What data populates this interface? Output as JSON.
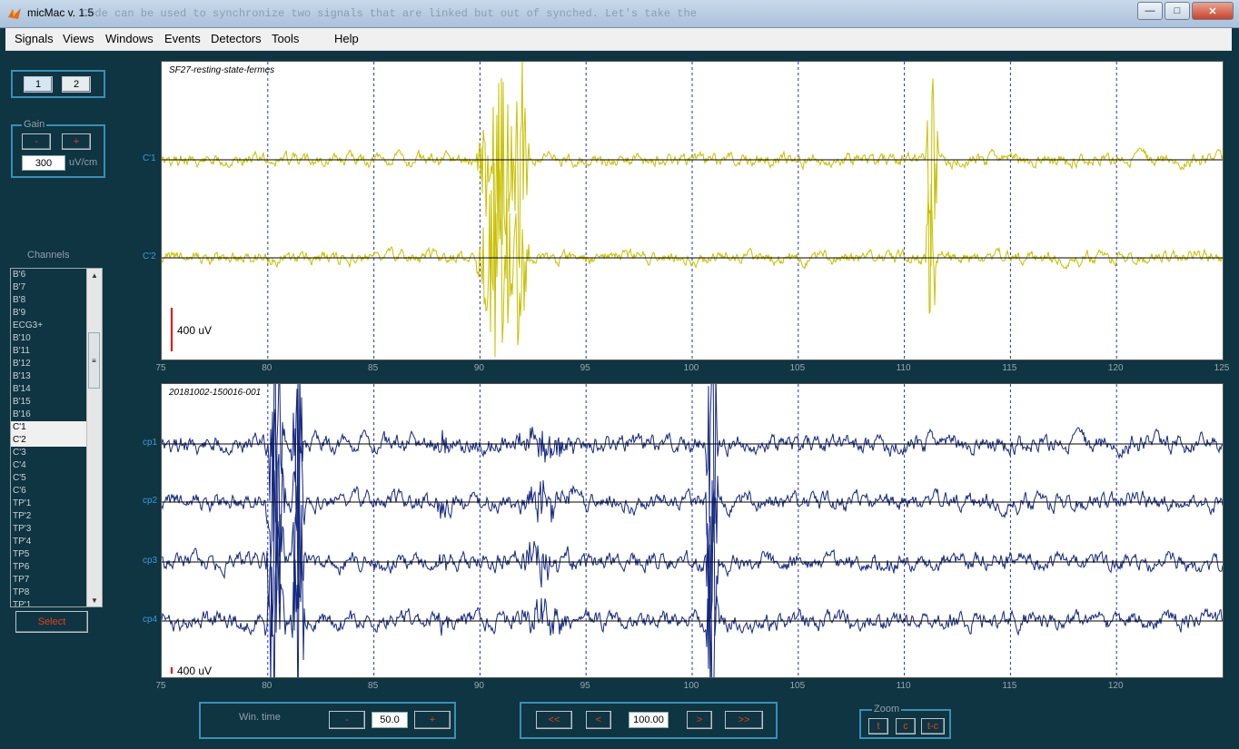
{
  "window": {
    "title": "micMac v. 1.5",
    "background_tab_text": "Code can be used to synchronize two signals that are linked but out of synched. Let's take the"
  },
  "menu": [
    "Signals",
    "Views",
    "Windows",
    "Events",
    "Detectors",
    "Tools",
    "Help"
  ],
  "page_buttons": [
    "1",
    "2"
  ],
  "gain": {
    "title": "Gain",
    "minus": "-",
    "plus": "+",
    "value": "300",
    "unit": "uV/cm"
  },
  "channels": {
    "title": "Channels",
    "items": [
      "B'6",
      "B'7",
      "B'8",
      "B'9",
      "ECG3+",
      "B'10",
      "B'11",
      "B'12",
      "B'13",
      "B'14",
      "B'15",
      "B'16",
      "C'1",
      "C'2",
      "C'3",
      "C'4",
      "C'5",
      "C'6",
      "TP'1",
      "TP'2",
      "TP'3",
      "TP'4",
      "TP5",
      "TP6",
      "TP7",
      "TP8",
      "TP'1"
    ],
    "selected": [
      "C'1",
      "C'2"
    ],
    "select_label": "Select"
  },
  "plot1": {
    "title": "SF27-resting-state-fermes",
    "channels": [
      "C'1",
      "C'2"
    ],
    "scale_label": "400 uV",
    "trace_color": "#c8c000",
    "x_ticks": [
      "75",
      "80",
      "85",
      "90",
      "95",
      "100",
      "105",
      "110",
      "115",
      "120",
      "125"
    ]
  },
  "plot2": {
    "title": "20181002-150016-001",
    "channels": [
      "cp1",
      "cp2",
      "cp3",
      "cp4"
    ],
    "scale_label": "400 uV",
    "trace_color": "#16287e",
    "x_ticks": [
      "75",
      "80",
      "85",
      "90",
      "95",
      "100",
      "105",
      "110",
      "115",
      "120"
    ]
  },
  "wintime": {
    "label": "Win. time",
    "minus": "-",
    "value": "50.0",
    "plus": "+"
  },
  "nav": {
    "first": "<<",
    "prev": "<",
    "value": "100.00",
    "next": ">",
    "last": ">>"
  },
  "zoom": {
    "title": "Zoom",
    "buttons": [
      "t",
      "c",
      "t-c"
    ]
  },
  "colors": {
    "panel_border": "#3a8fb5",
    "background": "#0f3442",
    "label": "#3a9bd6",
    "grid": "#1e33c8"
  }
}
